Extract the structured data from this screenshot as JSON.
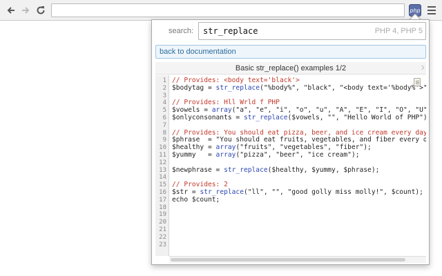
{
  "browser": {
    "back_icon": "back-arrow-icon",
    "forward_icon": "forward-arrow-icon",
    "reload_icon": "reload-icon",
    "address": "",
    "extension_label": "php",
    "menu_icon": "hamburger-menu-icon"
  },
  "popup": {
    "search_label": "search:",
    "search_value": "str_replace",
    "search_versions": "PHP 4, PHP 5",
    "back_label": "back to documentation",
    "example_title": "Basic str_replace() examples 1/2",
    "next_icon": "chevron-right-icon",
    "copy_icon": "clipboard-icon"
  },
  "code": {
    "line_numbers": [
      "1",
      "2",
      "3",
      "4",
      "5",
      "6",
      "7",
      "8",
      "9",
      "10",
      "11",
      "12",
      "13",
      "14",
      "15",
      "16",
      "17",
      "18",
      "19",
      "20",
      "21",
      "22",
      "23"
    ],
    "lines": [
      "// Provides: <body text='black'>",
      "$bodytag = str_replace(\"%body%\", \"black\", \"<body text='%body%'>\");",
      "",
      "// Provides: Hll Wrld f PHP",
      "$vowels = array(\"a\", \"e\", \"i\", \"o\", \"u\", \"A\", \"E\", \"I\", \"O\", \"U\");",
      "$onlyconsonants = str_replace($vowels, \"\", \"Hello World of PHP\");",
      "",
      "// Provides: You should eat pizza, beer, and ice cream every day",
      "$phrase  = \"You should eat fruits, vegetables, and fiber every day.\";",
      "$healthy = array(\"fruits\", \"vegetables\", \"fiber\");",
      "$yummy   = array(\"pizza\", \"beer\", \"ice cream\");",
      "",
      "$newphrase = str_replace($healthy, $yummy, $phrase);",
      "",
      "// Provides: 2",
      "$str = str_replace(\"ll\", \"\", \"good golly miss molly!\", $count);",
      "echo $count;",
      "",
      "",
      "",
      "",
      "",
      ""
    ],
    "comment_color": "#c0392b",
    "function_color": "#2b46b0"
  }
}
